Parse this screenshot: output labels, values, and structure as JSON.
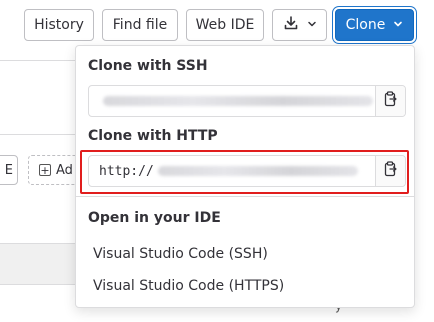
{
  "toolbar": {
    "history_label": "History",
    "find_file_label": "Find file",
    "web_ide_label": "Web IDE",
    "download_icon": "download-icon",
    "clone_label": "Clone"
  },
  "background": {
    "chip_e_text": "E",
    "chip_add_text": "Ad",
    "snippet": "y"
  },
  "clone_dropdown": {
    "ssh": {
      "label": "Clone with SSH",
      "value": ""
    },
    "http": {
      "label": "Clone with HTTP",
      "value_prefix": "http://"
    },
    "ide": {
      "label": "Open in your IDE",
      "items": [
        {
          "label": "Visual Studio Code (SSH)"
        },
        {
          "label": "Visual Studio Code (HTTPS)"
        }
      ]
    }
  },
  "colors": {
    "primary": "#1f75cb",
    "highlight": "#e11d1d",
    "border": "#dcdcde"
  }
}
